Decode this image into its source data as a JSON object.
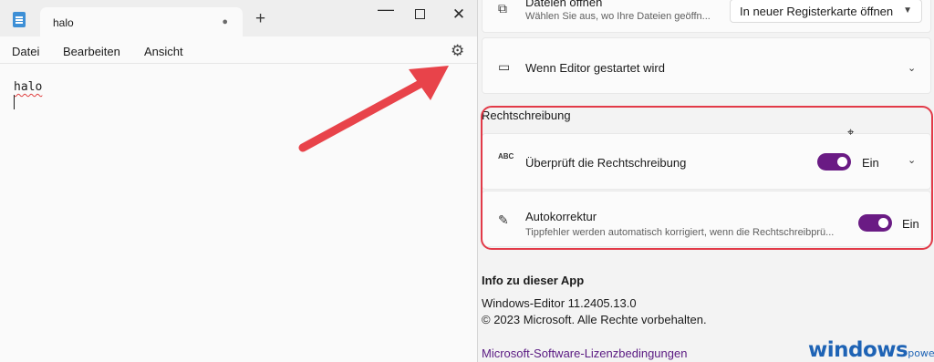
{
  "notepad": {
    "tab_title": "halo",
    "tab_modified_dot": "●",
    "new_tab_symbol": "+",
    "window_controls": {
      "minimize": "—",
      "close": "✕"
    },
    "menu": [
      "Datei",
      "Bearbeiten",
      "Ansicht"
    ],
    "settings_icon": "gear-icon",
    "editor_text": "halo",
    "annotation_arrow_color": "#e8434a"
  },
  "settings": {
    "open_files": {
      "title": "Dateien öffnen",
      "subtitle": "Wählen Sie aus, wo Ihre Dateien geöffn...",
      "dropdown_value": "In neuer Registerkarte öffnen"
    },
    "startup": {
      "title": "Wenn Editor gestartet wird"
    },
    "spelling_section": "Rechtschreibung",
    "spellcheck": {
      "title": "Überprüft die Rechtschreibung",
      "icon_text": "ABC",
      "toggle_state": "Ein"
    },
    "autocorrect": {
      "title": "Autokorrektur",
      "subtitle": "Tippfehler werden automatisch korrigiert, wenn die Rechtschreibprü...",
      "toggle_state": "Ein"
    },
    "about": {
      "title": "Info zu dieser App",
      "version": "Windows-Editor 11.2405.13.0",
      "copyright": "© 2023 Microsoft. Alle Rechte vorbehalten.",
      "license_link": "Microsoft-Software-Lizenzbedingungen"
    },
    "accent_color": "#6a1b84",
    "highlight_color": "#e23a48"
  },
  "watermark": {
    "main": "windows",
    "sub": "power"
  }
}
